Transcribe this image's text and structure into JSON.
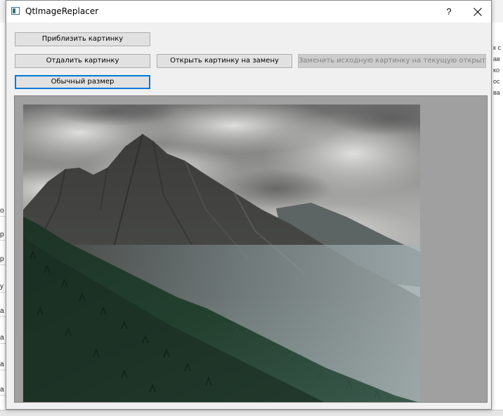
{
  "window": {
    "title": "QtImageReplacer",
    "help_symbol": "?"
  },
  "toolbar": {
    "zoom_in_label": "Приблизить картинку",
    "zoom_out_label": "Отдалить картинку",
    "open_replacement_label": "Открыть картинку на замену",
    "replace_original_label": "Заменить исходную картинку на текущую открытую",
    "normal_size_label": "Обычный размер"
  },
  "image": {
    "description": "mountain-landscape"
  },
  "background": {
    "left_fragments": [
      "о",
      "р",
      "р",
      "у",
      "а",
      "а",
      "а",
      "а"
    ],
    "right_fragments": [
      "к с",
      "ав",
      "ко",
      "ос",
      "ва"
    ]
  },
  "colors": {
    "focus_border": "#0078d7",
    "viewer_background": "#a0a0a0"
  }
}
